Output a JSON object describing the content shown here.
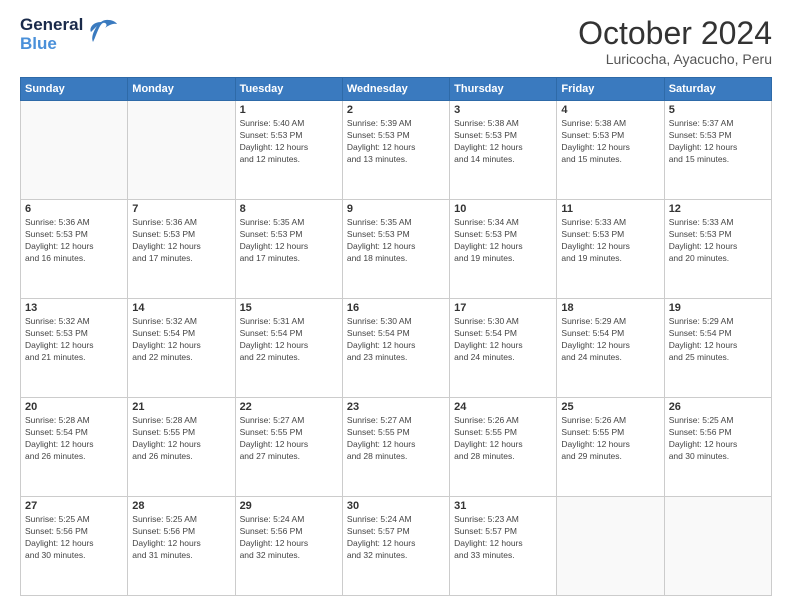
{
  "header": {
    "logo_line1": "General",
    "logo_line2": "Blue",
    "month": "October 2024",
    "location": "Luricocha, Ayacucho, Peru"
  },
  "weekdays": [
    "Sunday",
    "Monday",
    "Tuesday",
    "Wednesday",
    "Thursday",
    "Friday",
    "Saturday"
  ],
  "weeks": [
    [
      {
        "day": "",
        "info": ""
      },
      {
        "day": "",
        "info": ""
      },
      {
        "day": "1",
        "info": "Sunrise: 5:40 AM\nSunset: 5:53 PM\nDaylight: 12 hours\nand 12 minutes."
      },
      {
        "day": "2",
        "info": "Sunrise: 5:39 AM\nSunset: 5:53 PM\nDaylight: 12 hours\nand 13 minutes."
      },
      {
        "day": "3",
        "info": "Sunrise: 5:38 AM\nSunset: 5:53 PM\nDaylight: 12 hours\nand 14 minutes."
      },
      {
        "day": "4",
        "info": "Sunrise: 5:38 AM\nSunset: 5:53 PM\nDaylight: 12 hours\nand 15 minutes."
      },
      {
        "day": "5",
        "info": "Sunrise: 5:37 AM\nSunset: 5:53 PM\nDaylight: 12 hours\nand 15 minutes."
      }
    ],
    [
      {
        "day": "6",
        "info": "Sunrise: 5:36 AM\nSunset: 5:53 PM\nDaylight: 12 hours\nand 16 minutes."
      },
      {
        "day": "7",
        "info": "Sunrise: 5:36 AM\nSunset: 5:53 PM\nDaylight: 12 hours\nand 17 minutes."
      },
      {
        "day": "8",
        "info": "Sunrise: 5:35 AM\nSunset: 5:53 PM\nDaylight: 12 hours\nand 17 minutes."
      },
      {
        "day": "9",
        "info": "Sunrise: 5:35 AM\nSunset: 5:53 PM\nDaylight: 12 hours\nand 18 minutes."
      },
      {
        "day": "10",
        "info": "Sunrise: 5:34 AM\nSunset: 5:53 PM\nDaylight: 12 hours\nand 19 minutes."
      },
      {
        "day": "11",
        "info": "Sunrise: 5:33 AM\nSunset: 5:53 PM\nDaylight: 12 hours\nand 19 minutes."
      },
      {
        "day": "12",
        "info": "Sunrise: 5:33 AM\nSunset: 5:53 PM\nDaylight: 12 hours\nand 20 minutes."
      }
    ],
    [
      {
        "day": "13",
        "info": "Sunrise: 5:32 AM\nSunset: 5:53 PM\nDaylight: 12 hours\nand 21 minutes."
      },
      {
        "day": "14",
        "info": "Sunrise: 5:32 AM\nSunset: 5:54 PM\nDaylight: 12 hours\nand 22 minutes."
      },
      {
        "day": "15",
        "info": "Sunrise: 5:31 AM\nSunset: 5:54 PM\nDaylight: 12 hours\nand 22 minutes."
      },
      {
        "day": "16",
        "info": "Sunrise: 5:30 AM\nSunset: 5:54 PM\nDaylight: 12 hours\nand 23 minutes."
      },
      {
        "day": "17",
        "info": "Sunrise: 5:30 AM\nSunset: 5:54 PM\nDaylight: 12 hours\nand 24 minutes."
      },
      {
        "day": "18",
        "info": "Sunrise: 5:29 AM\nSunset: 5:54 PM\nDaylight: 12 hours\nand 24 minutes."
      },
      {
        "day": "19",
        "info": "Sunrise: 5:29 AM\nSunset: 5:54 PM\nDaylight: 12 hours\nand 25 minutes."
      }
    ],
    [
      {
        "day": "20",
        "info": "Sunrise: 5:28 AM\nSunset: 5:54 PM\nDaylight: 12 hours\nand 26 minutes."
      },
      {
        "day": "21",
        "info": "Sunrise: 5:28 AM\nSunset: 5:55 PM\nDaylight: 12 hours\nand 26 minutes."
      },
      {
        "day": "22",
        "info": "Sunrise: 5:27 AM\nSunset: 5:55 PM\nDaylight: 12 hours\nand 27 minutes."
      },
      {
        "day": "23",
        "info": "Sunrise: 5:27 AM\nSunset: 5:55 PM\nDaylight: 12 hours\nand 28 minutes."
      },
      {
        "day": "24",
        "info": "Sunrise: 5:26 AM\nSunset: 5:55 PM\nDaylight: 12 hours\nand 28 minutes."
      },
      {
        "day": "25",
        "info": "Sunrise: 5:26 AM\nSunset: 5:55 PM\nDaylight: 12 hours\nand 29 minutes."
      },
      {
        "day": "26",
        "info": "Sunrise: 5:25 AM\nSunset: 5:56 PM\nDaylight: 12 hours\nand 30 minutes."
      }
    ],
    [
      {
        "day": "27",
        "info": "Sunrise: 5:25 AM\nSunset: 5:56 PM\nDaylight: 12 hours\nand 30 minutes."
      },
      {
        "day": "28",
        "info": "Sunrise: 5:25 AM\nSunset: 5:56 PM\nDaylight: 12 hours\nand 31 minutes."
      },
      {
        "day": "29",
        "info": "Sunrise: 5:24 AM\nSunset: 5:56 PM\nDaylight: 12 hours\nand 32 minutes."
      },
      {
        "day": "30",
        "info": "Sunrise: 5:24 AM\nSunset: 5:57 PM\nDaylight: 12 hours\nand 32 minutes."
      },
      {
        "day": "31",
        "info": "Sunrise: 5:23 AM\nSunset: 5:57 PM\nDaylight: 12 hours\nand 33 minutes."
      },
      {
        "day": "",
        "info": ""
      },
      {
        "day": "",
        "info": ""
      }
    ]
  ]
}
